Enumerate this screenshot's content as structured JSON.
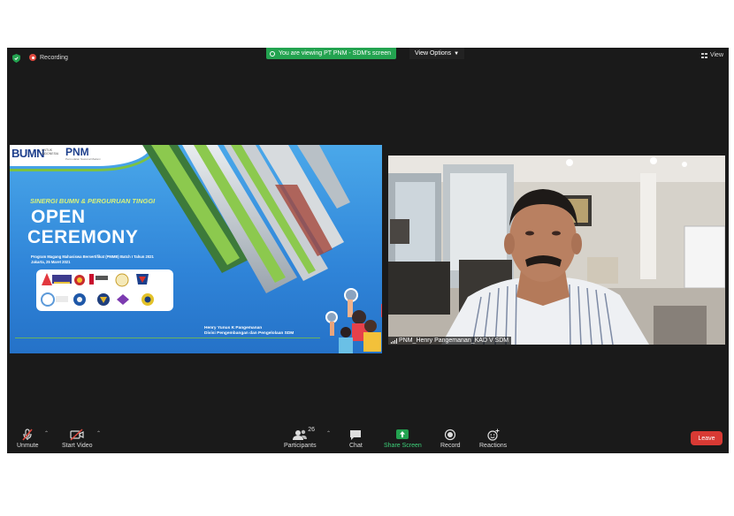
{
  "topbar": {
    "recording_label": "Recording",
    "viewing_label": "You are viewing PT PNM - SDM's screen",
    "view_options_label": "View Options",
    "view_label": "View"
  },
  "slide": {
    "logo_bumn": "BUMN",
    "logo_untuk": "UNTUK INDONESIA",
    "logo_pnm": "PNM",
    "logo_pnm_sub": "Permodalan Nasional Madani",
    "subtitle": "SINERGI BUMN & PERGURUAN TINGGI",
    "title_line1": "OPEN",
    "title_line2": "CEREMONY",
    "program": "Program Magang Mahasiswa Bersertifikat (PMMB) Batch I Tahun 2021",
    "place_date": "Jakarta,  25 Maret 2021",
    "presenter": "Henry Yunus K Pangemanan",
    "division": "Divisi Pengembangan dan Pengelolaan SDM"
  },
  "participant": {
    "name": "PNM_Henry Pangemanan_KAD V SDM"
  },
  "toolbar": {
    "unmute": "Unmute",
    "start_video": "Start Video",
    "participants": "Participants",
    "participants_count": "26",
    "chat": "Chat",
    "share_screen": "Share Screen",
    "record": "Record",
    "reactions": "Reactions",
    "leave": "Leave"
  },
  "colors": {
    "share_green": "#23a350",
    "leave_red": "#d83a34",
    "slide_blue": "#2f84d8",
    "slide_green": "#7cc242"
  }
}
